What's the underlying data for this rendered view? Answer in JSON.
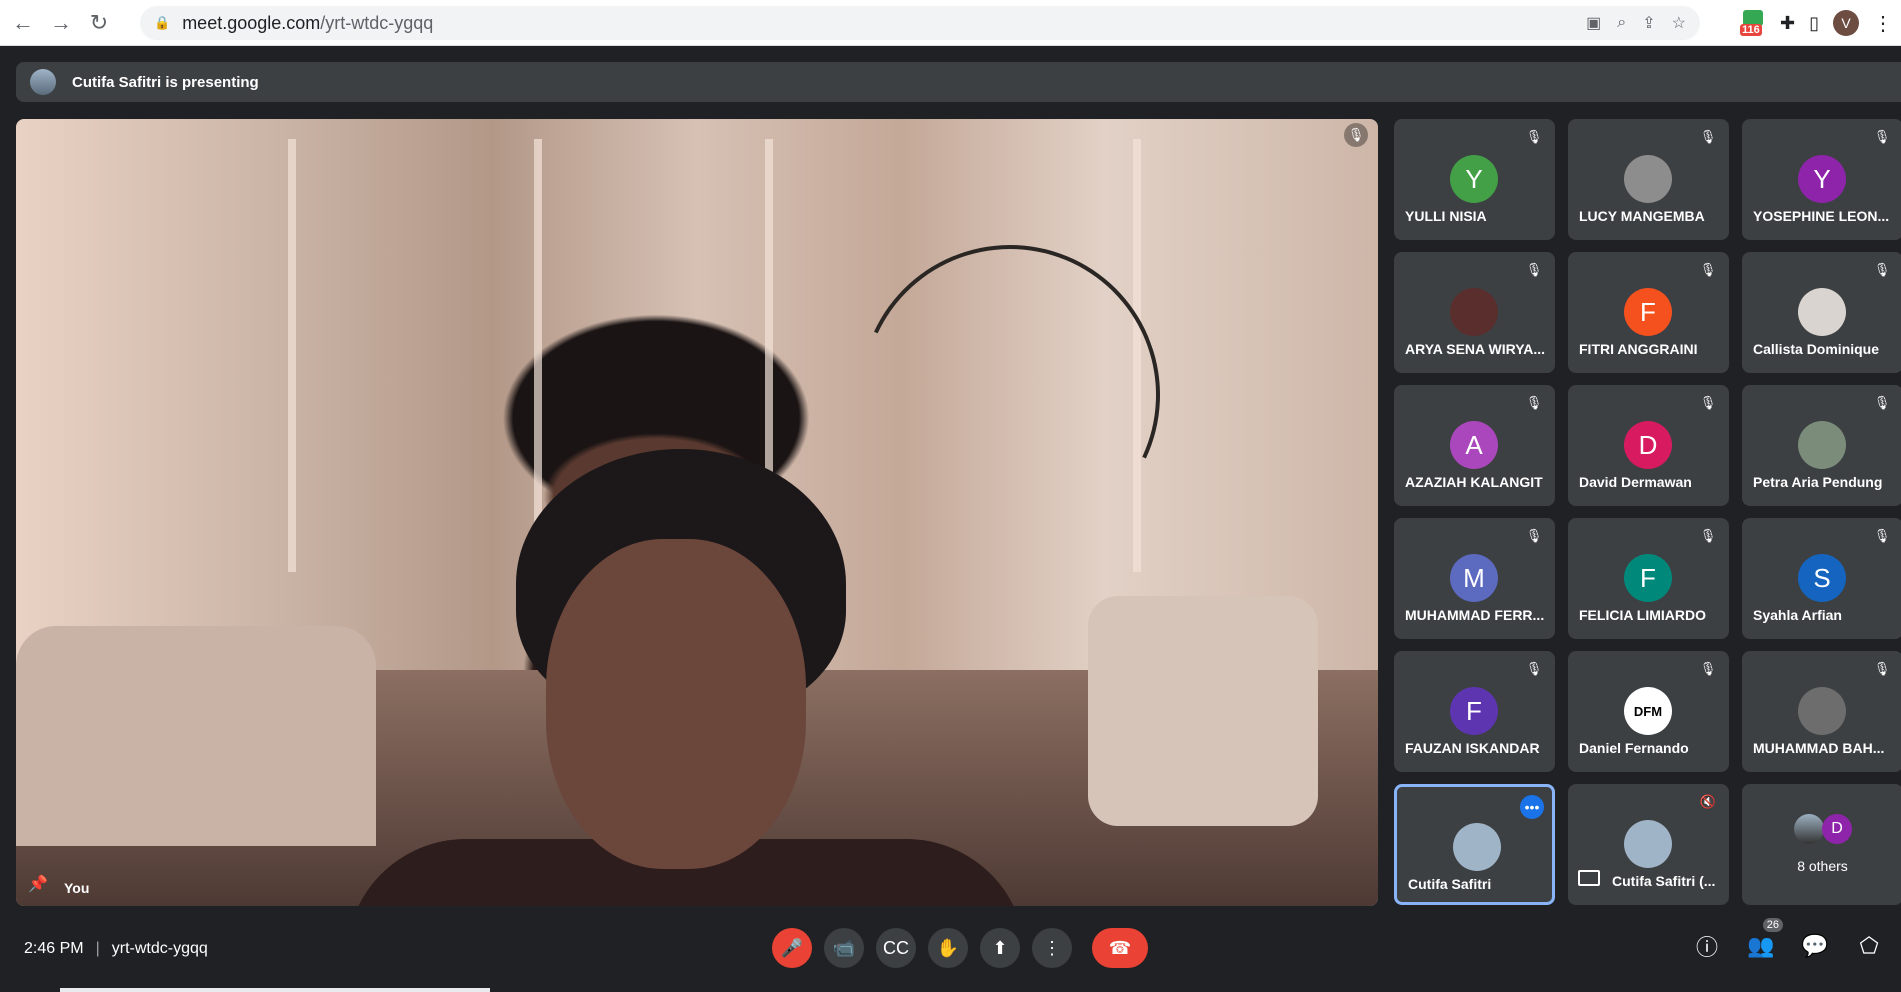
{
  "browser": {
    "url_host": "meet.google.com",
    "url_path": "/yrt-wtdc-ygqq",
    "ext_badge": "116",
    "profile_initial": "V"
  },
  "banner": {
    "text": "Cutifa Safitri is presenting"
  },
  "main": {
    "name": "You"
  },
  "tiles": [
    {
      "name": "YULLI NISIA",
      "initial": "Y",
      "color": "#43a047"
    },
    {
      "name": "LUCY MANGEMBA",
      "initial": "",
      "color": "#8d8d8d"
    },
    {
      "name": "YOSEPHINE LEON...",
      "initial": "Y",
      "color": "#8e24aa"
    },
    {
      "name": "ARYA SENA WIRYA...",
      "initial": "",
      "color": "#5b2e2e"
    },
    {
      "name": "FITRI ANGGRAINI",
      "initial": "F",
      "color": "#f4511e"
    },
    {
      "name": "Callista Dominique",
      "initial": "",
      "color": "#d9d4cf"
    },
    {
      "name": "AZAZIAH KALANGIT",
      "initial": "A",
      "color": "#ab47bc"
    },
    {
      "name": "David Dermawan",
      "initial": "D",
      "color": "#d81b60"
    },
    {
      "name": "Petra Aria Pendung",
      "initial": "",
      "color": "#7b8c7b"
    },
    {
      "name": "MUHAMMAD FERR...",
      "initial": "M",
      "color": "#5c6bc0"
    },
    {
      "name": "FELICIA LIMIARDO",
      "initial": "F",
      "color": "#00897b"
    },
    {
      "name": "Syahla Arfian",
      "initial": "S",
      "color": "#1565c0"
    },
    {
      "name": "FAUZAN ISKANDAR",
      "initial": "F",
      "color": "#5e35b1"
    },
    {
      "name": "Daniel Fernando",
      "initial": "DFM",
      "color": "#ffffff"
    },
    {
      "name": "MUHAMMAD BAH...",
      "initial": "",
      "color": "#6d6d6d"
    },
    {
      "name": "Cutifa Safitri",
      "initial": "",
      "color": "#9fb4c7"
    },
    {
      "name": "Cutifa Safitri (...",
      "initial": "",
      "color": "#9fb4c7"
    }
  ],
  "others": {
    "text": "8 others",
    "initial": "D"
  },
  "bottom": {
    "time": "2:46 PM",
    "code": "yrt-wtdc-ygqq",
    "participants": "26"
  }
}
